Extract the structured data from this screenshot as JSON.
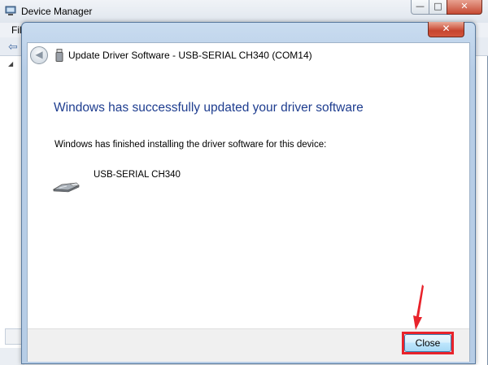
{
  "device_manager": {
    "title": "Device Manager",
    "menu_first": "Fil",
    "minimize_glyph": "—",
    "maximize_glyph": "□",
    "close_glyph": "✕"
  },
  "dialog": {
    "close_glyph": "✕",
    "back_glyph": "◀",
    "header_title": "Update Driver Software - USB-SERIAL CH340 (COM14)",
    "heading": "Windows has successfully updated your driver software",
    "message": "Windows has finished installing the driver software for this device:",
    "device_name": "USB-SERIAL CH340",
    "close_button_label": "Close"
  },
  "colors": {
    "heading": "#1e3d8f",
    "annotation_red": "#e8232b"
  },
  "icons": {
    "device_manager": "device-manager-icon",
    "usb_device": "usb-plug-icon",
    "header_usb": "usb-drive-icon",
    "annotation": "red-arrow-annotation"
  }
}
